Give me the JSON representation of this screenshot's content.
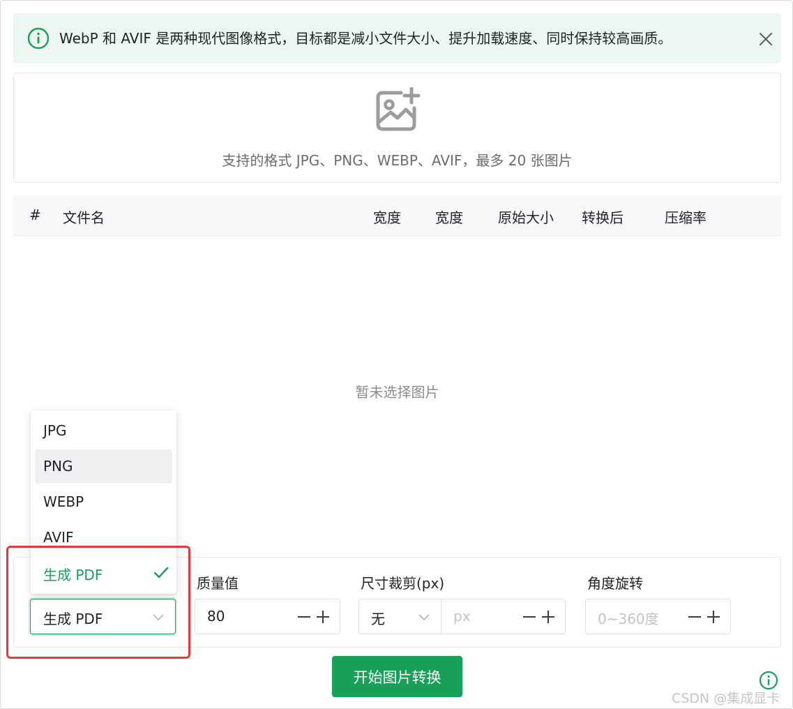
{
  "alert": {
    "message": "WebP 和 AVIF 是两种现代图像格式，目标都是减小文件大小、提升加载速度、同时保持较高画质。",
    "icon": "info-circle-icon",
    "close_icon": "close-icon",
    "color": "#18a058"
  },
  "upload": {
    "icon": "add-image-icon",
    "hint": "支持的格式 JPG、PNG、WEBP、AVIF，最多 20 张图片"
  },
  "table": {
    "columns": [
      "#",
      "文件名",
      "宽度",
      "宽度",
      "原始大小",
      "转换后",
      "压缩率"
    ],
    "empty_text": "暂未选择图片"
  },
  "settings": {
    "format": {
      "value": "生成 PDF",
      "options": [
        "JPG",
        "PNG",
        "WEBP",
        "AVIF",
        "生成 PDF"
      ],
      "hovered": "PNG",
      "selected": "生成 PDF"
    },
    "quality": {
      "label": "质量值",
      "value": "80"
    },
    "resize": {
      "label": "尺寸裁剪(px)",
      "mode": "无",
      "placeholder": "px"
    },
    "rotate": {
      "label": "角度旋转",
      "placeholder": "0~360度"
    }
  },
  "start_button": "开始图片转换",
  "watermark": "CSDN @集成显卡",
  "colors": {
    "primary": "#18a058",
    "highlight": "#e0393e",
    "alert_bg": "#edf7f1"
  }
}
